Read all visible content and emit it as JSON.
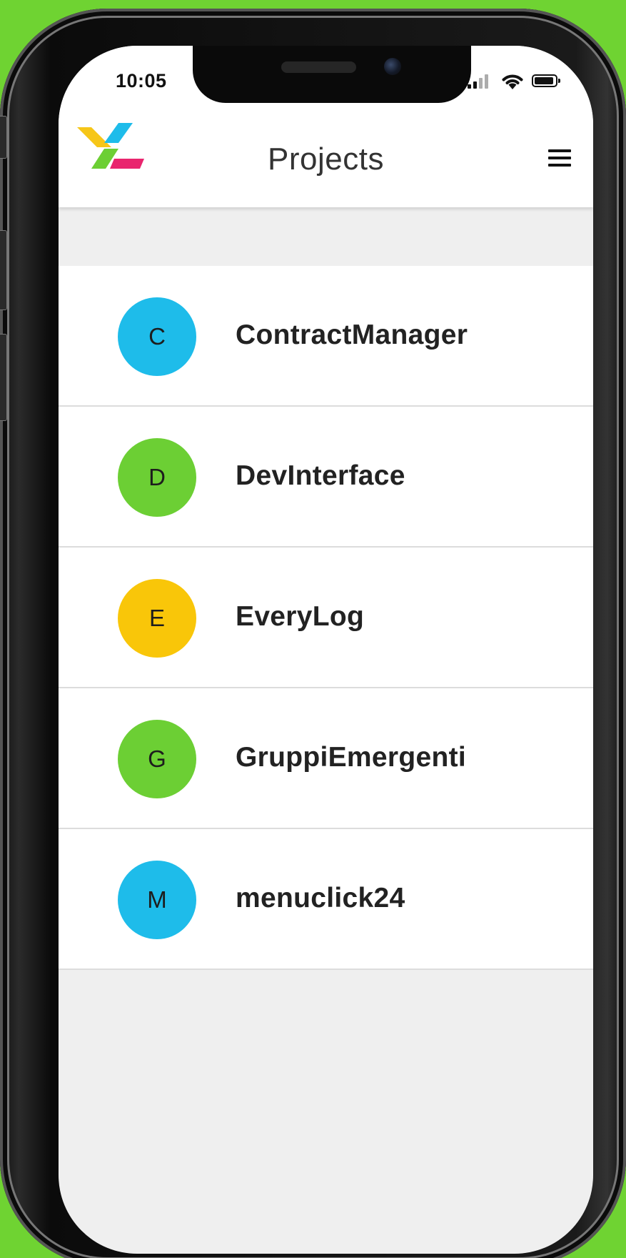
{
  "status_bar": {
    "time": "10:05"
  },
  "header": {
    "title": "Projects",
    "logo_icon": "app-logo",
    "menu_icon": "hamburger-menu-icon"
  },
  "projects": [
    {
      "initial": "C",
      "name": "ContractManager",
      "color": "#1ebcea"
    },
    {
      "initial": "D",
      "name": "DevInterface",
      "color": "#6ccf34"
    },
    {
      "initial": "E",
      "name": "EveryLog",
      "color": "#f9c609"
    },
    {
      "initial": "G",
      "name": "GruppiEmergenti",
      "color": "#6ccf34"
    },
    {
      "initial": "M",
      "name": "menuclick24",
      "color": "#1ebcea"
    }
  ],
  "colors": {
    "background": "#6fd332",
    "logo_yellow": "#f6c618",
    "logo_blue": "#1ebcea",
    "logo_green": "#6ccf34",
    "logo_pink": "#e9256e"
  }
}
